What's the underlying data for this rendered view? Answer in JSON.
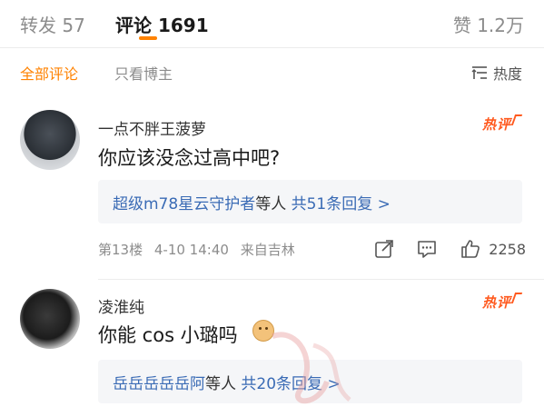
{
  "tabs": {
    "repost": {
      "label": "转发",
      "count": "57"
    },
    "comments": {
      "label": "评论",
      "count": "1691"
    },
    "likes": {
      "label": "赞",
      "count": "1.2万"
    }
  },
  "filters": {
    "all": "全部评论",
    "author_only": "只看博主",
    "sort": "热度"
  },
  "colors": {
    "accent": "#ff8200",
    "link": "#3a6bb5",
    "hot": "#ff5a1f"
  },
  "comments": [
    {
      "username": "一点不胖王菠萝",
      "badge": "热评",
      "text": "你应该没念过高中吧?",
      "replies": {
        "names": "超级m78星云守护者",
        "suffix": "等人",
        "count_text": "共51条回复 >"
      },
      "meta": {
        "floor": "第13楼",
        "time": "4-10 14:40",
        "location": "来自吉林"
      },
      "likes": "2258",
      "icons": [
        "share-icon",
        "comment-icon",
        "like-icon"
      ]
    },
    {
      "username": "凌淮纯",
      "badge": "热评",
      "text": "你能 cos 小璐吗",
      "sticker": "doge-emoji",
      "replies": {
        "names": "岳岳岳岳岳阿",
        "suffix": "等人",
        "count_text": "共20条回复 >"
      }
    }
  ]
}
